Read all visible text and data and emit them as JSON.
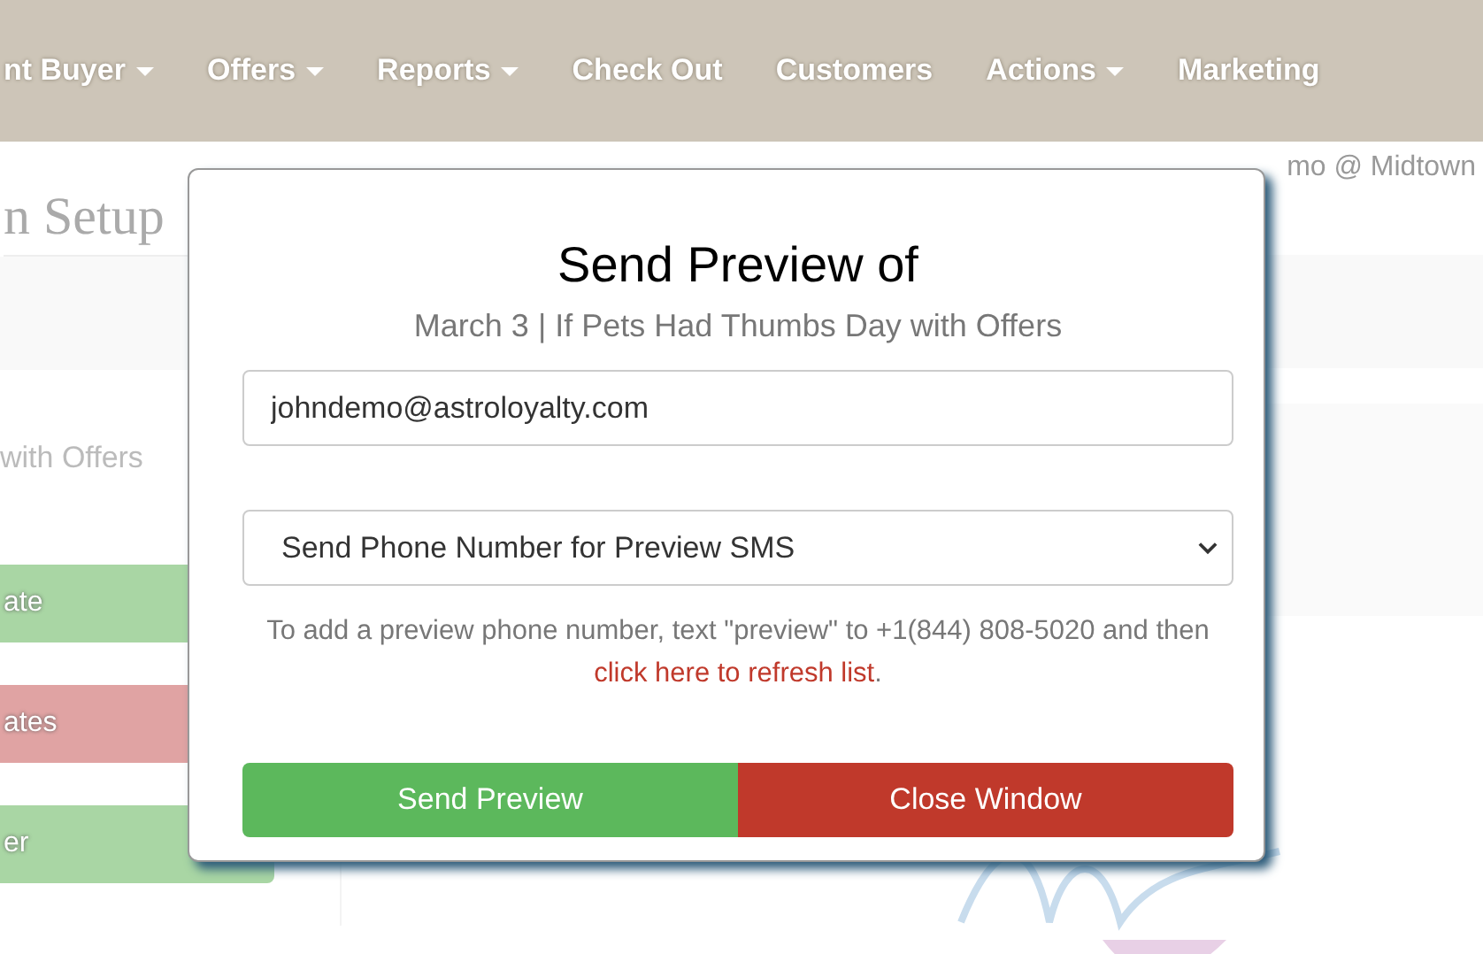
{
  "nav": {
    "items": [
      {
        "label": "nt Buyer",
        "dropdown": true
      },
      {
        "label": "Offers",
        "dropdown": true
      },
      {
        "label": "Reports",
        "dropdown": true
      },
      {
        "label": "Check Out",
        "dropdown": false
      },
      {
        "label": "Customers",
        "dropdown": false
      },
      {
        "label": "Actions",
        "dropdown": true
      },
      {
        "label": "Marketing",
        "dropdown": false
      }
    ]
  },
  "welcome": "mo @ Midtown",
  "page": {
    "title": "n Setup",
    "subtitle": "with Offers",
    "buttons": [
      {
        "label": "ate",
        "kind": "success"
      },
      {
        "label": "ates",
        "kind": "danger"
      },
      {
        "label": "er",
        "kind": "success"
      }
    ]
  },
  "modal": {
    "title": "Send Preview of",
    "subtitle": "March 3 | If Pets Had Thumbs Day with Offers",
    "email": {
      "value": "johndemo@astroloyalty.com"
    },
    "phone_select": {
      "value": "Send Phone Number for Preview SMS"
    },
    "help": {
      "text": "To add a preview phone number, text \"preview\" to +1(844) 808-5020 and then",
      "link": "click here to refresh list",
      "end": "."
    },
    "buttons": [
      {
        "label": "Send Preview",
        "kind": "success"
      },
      {
        "label": "Close Window",
        "kind": "danger"
      }
    ]
  }
}
